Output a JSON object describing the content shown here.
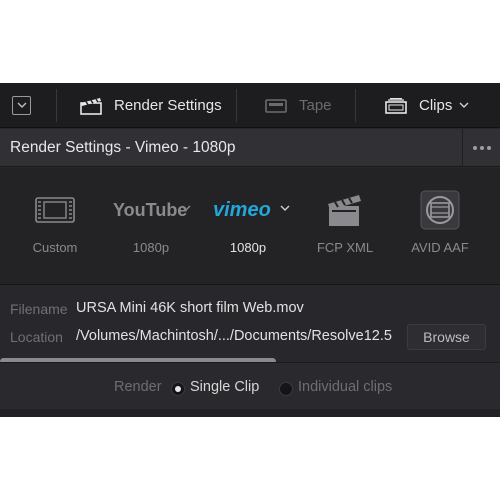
{
  "toolbar": {
    "collapse_icon": "chevron-down-icon",
    "render_settings_label": "Render Settings",
    "tape_label": "Tape",
    "clips_label": "Clips"
  },
  "title": {
    "text": "Render Settings - Vimeo - 1080p",
    "more_icon": "more-horizontal-icon"
  },
  "presets": [
    {
      "label": "Custom",
      "icon": "film-strip-icon"
    },
    {
      "label": "1080p",
      "icon": "youtube-logo",
      "logo_text": "YouTube"
    },
    {
      "label": "1080p",
      "icon": "vimeo-logo",
      "logo_text": "vimeo",
      "selected": true
    },
    {
      "label": "FCP XML",
      "icon": "clapperboard-icon"
    },
    {
      "label": "AVID AAF",
      "icon": "film-reel-icon"
    }
  ],
  "file": {
    "filename_label": "Filename",
    "filename_value": "URSA Mini 46K short film Web.mov",
    "location_label": "Location",
    "location_value": "/Volumes/Machintosh/.../Documents/Resolve12.5",
    "browse_label": "Browse"
  },
  "render": {
    "label": "Render",
    "single_clip": "Single Clip",
    "individual_clips": "Individual clips",
    "selected": "single_clip"
  },
  "colors": {
    "panel": "#28282c",
    "toolbar": "#1d1d20",
    "vimeo_blue": "#25a6d9"
  }
}
